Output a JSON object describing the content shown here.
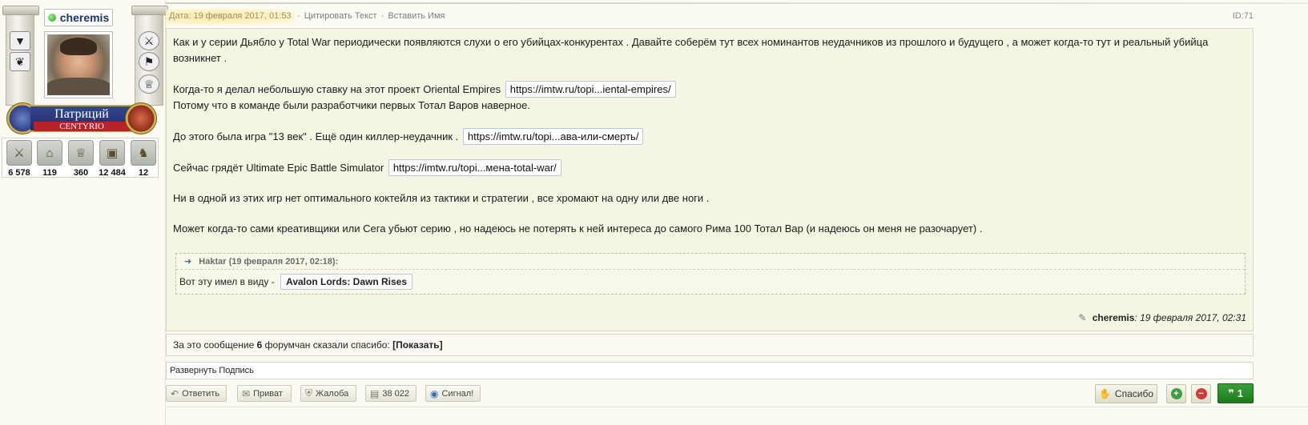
{
  "user": {
    "name": "cheremis",
    "rank_title": "Патриций",
    "rank_sub": "CENTYRIO",
    "stats": [
      "6 578",
      "119",
      "360",
      "12 484",
      "12"
    ]
  },
  "header": {
    "date": "Дата: 19 февраля 2017, 01:53",
    "quote_text": "Цитировать Текст",
    "insert_name": "Вставить Имя",
    "separator": "·",
    "post_id": "ID:71"
  },
  "post": {
    "p1": "Как и у серии Дьябло у Total War периодически появляются слухи о его убийцах-конкурентах . Давайте соберём тут всех номинантов неудачников из прошлого и будущего , а может когда-то тут и реальный убийца возникнет .",
    "p2_pre": "Когда-то я делал небольшую ставку на этот проект Oriental Empires",
    "link1": "https://imtw.ru/topi...iental-empires/",
    "p2_post": "Потому что в команде были разработчики первых Тотал Варов наверное.",
    "p3_pre": "До этого была игра \"13 век\" . Ещё один киллер-неудачник .",
    "link2": "https://imtw.ru/topi...ава-или-смерть/",
    "p4_pre": "Сейчас грядёт Ultimate Epic Battle Simulator",
    "link3": "https://imtw.ru/topi...мена-total-war/",
    "p5": "Ни в одной из этих игр нет оптимального коктейля из тактики и стратегии , все хромают на одну или две ноги .",
    "p6": "Может когда-то сами креативщики или Сега убьют серию , но надеюсь не потерять к ней интереса до самого Рима 100 Тотал Вар (и надеюсь он меня не разочарует) ."
  },
  "quote": {
    "head": "Haktar (19 февраля 2017, 02:18):",
    "text": "Вот эту имел в виду -",
    "link": "Avalon Lords: Dawn Rises"
  },
  "edit": {
    "author": "cheremis",
    "time": ": 19 февраля 2017, 02:31"
  },
  "thanks": {
    "pre": "За это сообщение",
    "count": "6",
    "post": "форумчан сказали спасибо:",
    "show": "[Показать]"
  },
  "signature_toggle": "Развернуть Подпись",
  "buttons": {
    "reply": "Ответить",
    "private": "Приват",
    "complaint": "Жалоба",
    "count": "38 022",
    "signal": "Сигнал!",
    "thanks": "Спасибо",
    "score": "1"
  }
}
